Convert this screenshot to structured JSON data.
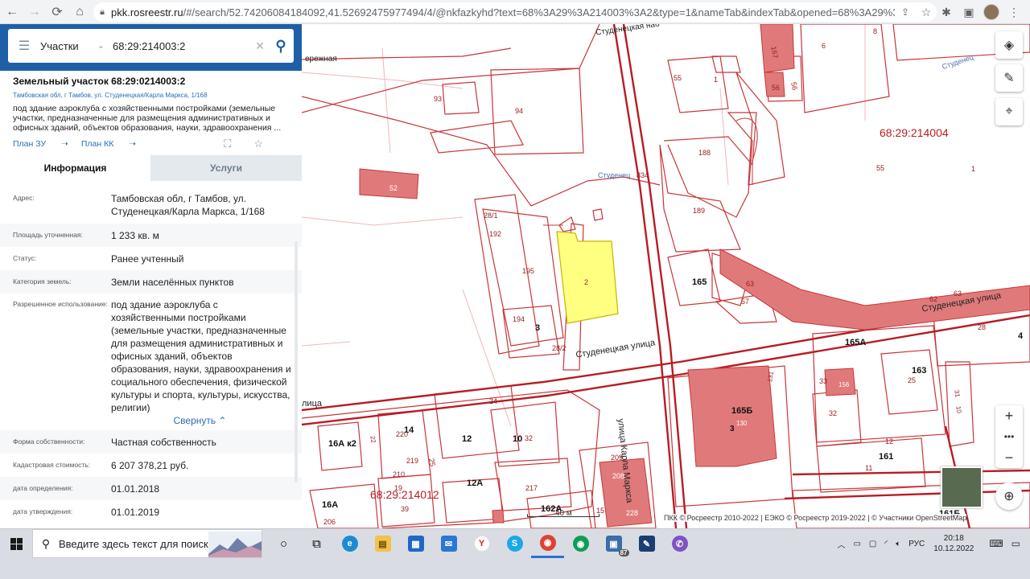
{
  "browser": {
    "url_host": "pkk.rosreestr.ru",
    "url_path": "/#/search/52.74206084184092,41.52692475977494/4/@nkfazkyhd?text=68%3A29%3A214003%3A2&type=1&nameTab&indexTab&opened=68%3A29%3A214003%3A2"
  },
  "search": {
    "type_label": "Участки",
    "query": "68:29:214003:2"
  },
  "parcel": {
    "title": "Земельный участок 68:29:0214003:2",
    "address_small": "Тамбовская обл, г Тамбов, ул. Студенецкая/Карла Маркса, 1/168",
    "description": "под здание аэроклуба с хозяйственными постройками (земельные участки, предназначенные для размещения административных и офисных зданий, объектов образования, науки, здравоохранения ...",
    "link_plan_zu": "План ЗУ",
    "link_plan_kk": "План КК"
  },
  "tabs": {
    "info": "Информация",
    "services": "Услуги"
  },
  "fields": [
    {
      "key": "Адрес:",
      "value": "Тамбовская обл, г Тамбов, ул. Студенецкая/Карла Маркса, 1/168"
    },
    {
      "key": "Площадь уточненная:",
      "value": "1 233 кв. м"
    },
    {
      "key": "Статус:",
      "value": "Ранее учтенный"
    },
    {
      "key": "Категория земель:",
      "value": "Земли населённых пунктов"
    },
    {
      "key": "Разрешенное использование:",
      "value": "под здание аэроклуба с хозяйственными постройками (земельные участки, предназначенные для размещения административных и офисных зданий, объектов образования, науки, здравоохранения и социального обеспечения, физической культуры и спорта, культуры, искусства, религии)"
    },
    {
      "key": "Форма собственности:",
      "value": "Частная собственность"
    },
    {
      "key": "Кадастровая стоимость:",
      "value": "6 207 378,21 руб."
    },
    {
      "key": "дата определения:",
      "value": "01.01.2018"
    },
    {
      "key": "дата утверждения:",
      "value": "01.01.2019"
    }
  ],
  "collapse_label": "Свернуть",
  "map": {
    "quarter_main": "68:29:214004",
    "quarter_bottom": "68:29:214012",
    "street_studenetskaya": "Студенецкая улица",
    "street_studenetskaya2": "Студенецкая улица",
    "street_marx": "улица Карла Маркса",
    "street_top": "Студенецкая наб",
    "street_left": "ережная",
    "creek_top": "Студенец",
    "creek_mid": "Студенец",
    "street_lica": "лица",
    "scale": "40 м",
    "attribution": "ПКК © Росреестр 2010-2022 | ЕЭКО © Росреестр 2019-2022 | © Участники OpenStreetMap",
    "labels": {
      "n93": "93",
      "n94": "94",
      "n55a": "55",
      "n1a": "1",
      "n8": "8",
      "n6": "6",
      "n167": "167",
      "n56": "56",
      "n56b": "56",
      "n52": "52",
      "n834": "834",
      "n188": "188",
      "n189": "189",
      "n55b": "55",
      "n1b": "1",
      "n281": "28/1",
      "n192": "192",
      "n195": "195",
      "n2": "2",
      "n194": "194",
      "n3a": "3",
      "n282": "28/2",
      "n165": "165",
      "n63a": "63",
      "n57": "57",
      "n62": "62",
      "n63b": "63",
      "n28": "28",
      "n165a": "165А",
      "n163": "163",
      "n25": "25",
      "n33": "33",
      "n156": "156",
      "n32a": "32",
      "n3b": "3",
      "n165b": "165Б",
      "n130": "130",
      "n131": "131",
      "n161": "161",
      "n12a": "12",
      "n11": "11",
      "n16ak2": "16А к2",
      "n14": "14",
      "n220": "220",
      "n12b": "12",
      "n10": "10",
      "n32b": "32",
      "n24": "24",
      "n219": "219",
      "n210": "210",
      "n12A": "12А",
      "n16A": "16А",
      "n39": "39",
      "n217": "217",
      "n209": "209",
      "n208": "208",
      "n162A": "162А",
      "n15": "15",
      "n228": "228",
      "n161b": "161Б",
      "n206": "206",
      "n25b": "25",
      "n19": "19",
      "n10b": "10",
      "n31": "31",
      "n4": "4",
      "n22": "22"
    }
  },
  "taskbar": {
    "search_placeholder": "Введите здесь текст для поиска",
    "badge": "87",
    "lang": "РУС",
    "time": "20:18",
    "date": "10.12.2022"
  },
  "colors": {
    "accent": "#1f5fa8",
    "parcel_yellow": "#ffff80",
    "building": "#e07a7a",
    "boundary": "#c0262c"
  }
}
